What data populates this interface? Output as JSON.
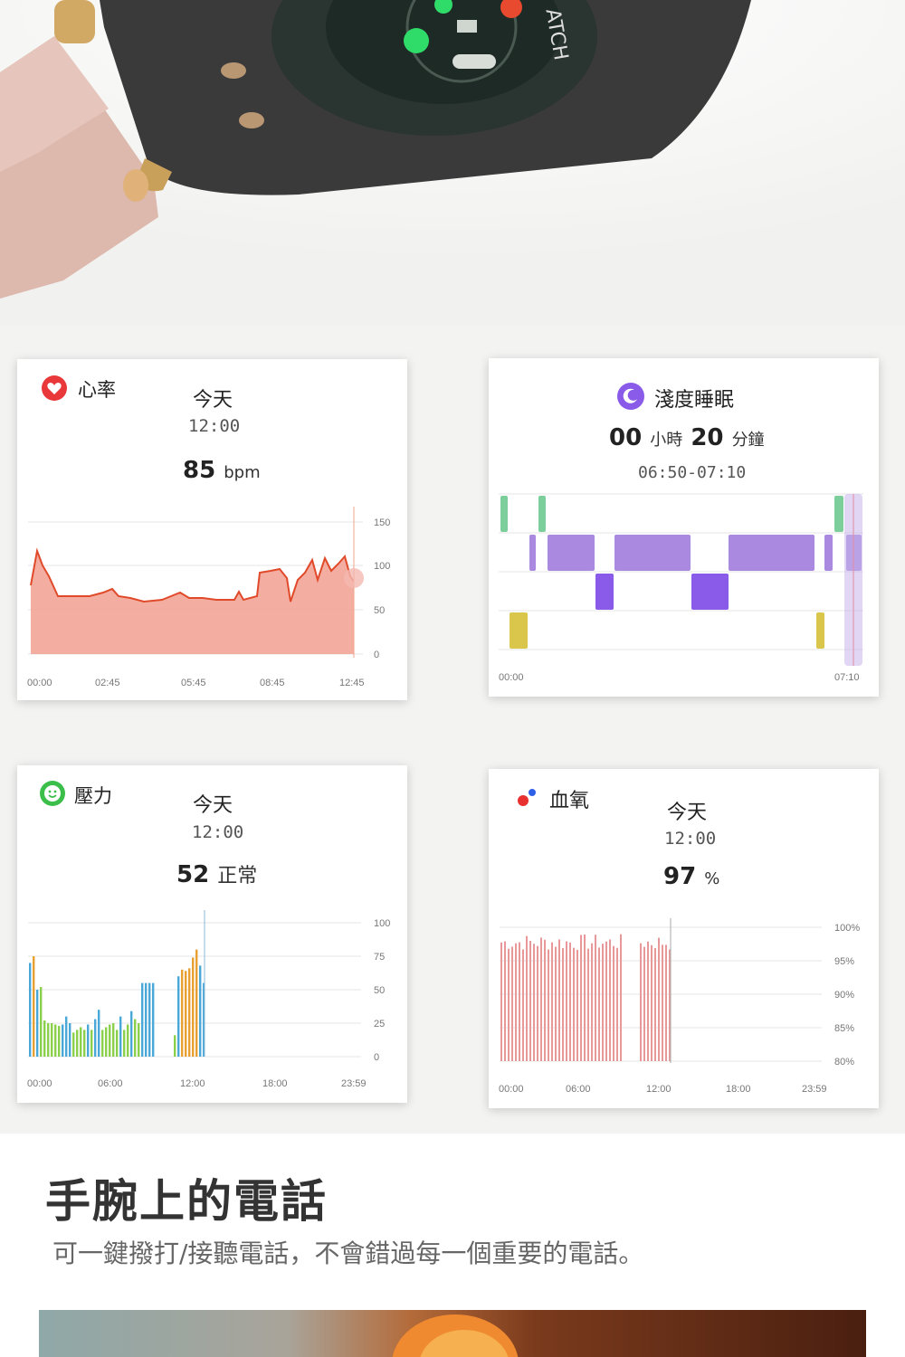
{
  "hero": {
    "brand_text": "ATCH"
  },
  "heart_card": {
    "label": "心率",
    "today": "今天",
    "time": "12:00",
    "value": "85",
    "unit": "bpm",
    "y_ticks": [
      "150",
      "100",
      "50",
      "0"
    ],
    "x_ticks": [
      "00:00",
      "02:45",
      "05:45",
      "08:45",
      "12:45"
    ],
    "colors": {
      "line": "#e04a2a",
      "fill": "#f2a090"
    }
  },
  "sleep_card": {
    "label": "淺度睡眠",
    "hours": "00",
    "hours_unit": "小時",
    "minutes": "20",
    "minutes_unit": "分鐘",
    "range": "06:50-07:10",
    "x_ticks": [
      "00:00",
      "07:10"
    ],
    "colors": {
      "awake": "#7ccf9a",
      "light": "#a98ae0",
      "deep": "#8a5be8",
      "rem": "#d9c64a"
    }
  },
  "stress_card": {
    "label": "壓力",
    "today": "今天",
    "time": "12:00",
    "value": "52",
    "status": "正常",
    "y_ticks": [
      "100",
      "75",
      "50",
      "25",
      "0"
    ],
    "x_ticks": [
      "00:00",
      "06:00",
      "12:00",
      "18:00",
      "23:59"
    ],
    "colors": {
      "relax": "#8ad04a",
      "normal": "#4aa8d8",
      "medium": "#e8a030"
    }
  },
  "spo2_card": {
    "label": "血氧",
    "today": "今天",
    "time": "12:00",
    "value": "97",
    "unit": "%",
    "y_ticks": [
      "100%",
      "95%",
      "90%",
      "85%",
      "80%"
    ],
    "x_ticks": [
      "00:00",
      "06:00",
      "12:00",
      "18:00",
      "23:59"
    ],
    "colors": {
      "bar": "#e89898"
    }
  },
  "call_section": {
    "title": "手腕上的電話",
    "subtitle": "可一鍵撥打/接聽電話，不會錯過每一個重要的電話。"
  }
}
